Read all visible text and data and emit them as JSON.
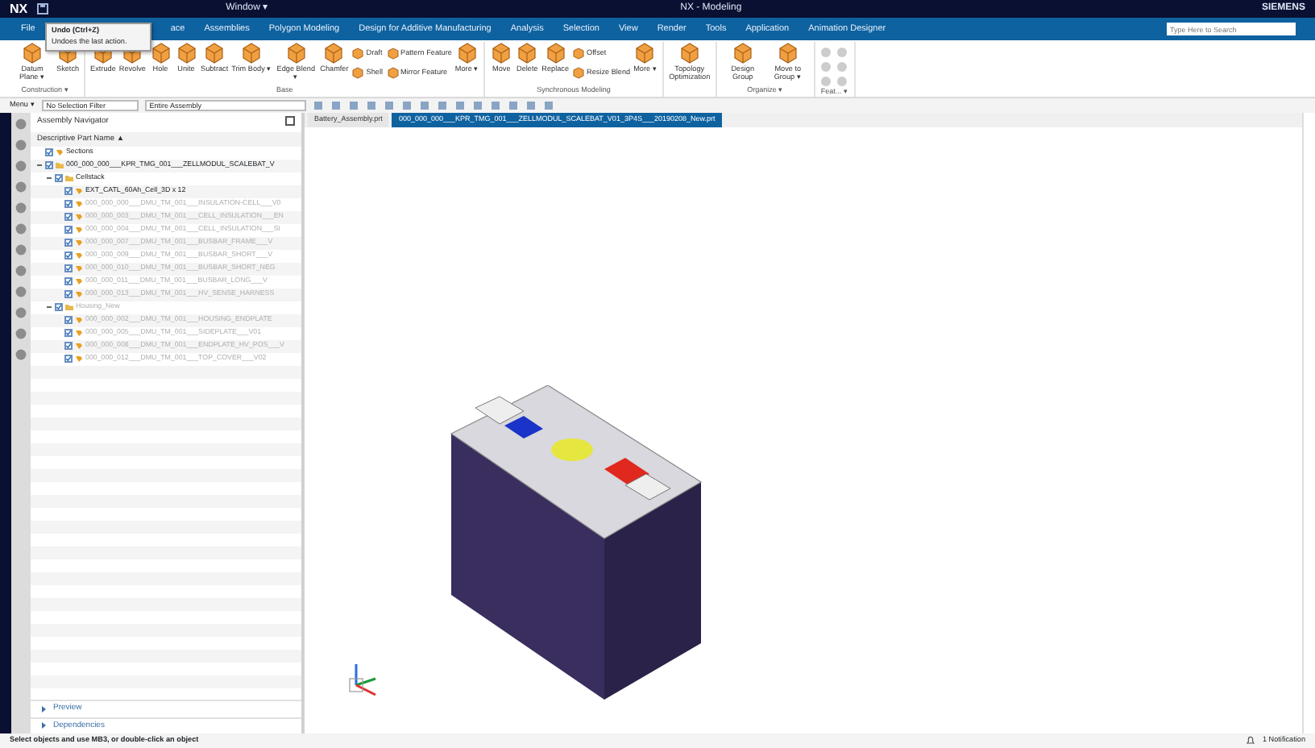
{
  "window": {
    "logo": "NX",
    "quick_access_menu": "Window ▾",
    "title": "NX - Modeling",
    "brand": "SIEMENS",
    "search": {
      "placeholder": "Type Here to Search"
    }
  },
  "menu_tabs": [
    {
      "label": "File",
      "selected": false
    },
    {
      "label": "ace",
      "selected": false
    },
    {
      "label": "Assemblies",
      "selected": false
    },
    {
      "label": "Polygon Modeling",
      "selected": false
    },
    {
      "label": "Design for Additive Manufacturing",
      "selected": false
    },
    {
      "label": "Analysis",
      "selected": false
    },
    {
      "label": "Selection",
      "selected": false
    },
    {
      "label": "View",
      "selected": false
    },
    {
      "label": "Render",
      "selected": false
    },
    {
      "label": "Tools",
      "selected": false
    },
    {
      "label": "Application",
      "selected": false
    },
    {
      "label": "Animation Designer",
      "selected": false
    }
  ],
  "tooltip": {
    "title": "Undo (Ctrl+Z)",
    "text": "Undoes the last action."
  },
  "ribbon_groups": [
    {
      "label": "Construction ▾",
      "items": [
        {
          "kind": "large",
          "label": "Datum Plane ▾"
        },
        {
          "kind": "large",
          "label": "Sketch"
        }
      ]
    },
    {
      "label": "Base",
      "items": [
        {
          "kind": "large",
          "label": "Extrude"
        },
        {
          "kind": "large",
          "label": "Revolve"
        },
        {
          "kind": "large",
          "label": "Hole"
        },
        {
          "kind": "large",
          "label": "Unite"
        },
        {
          "kind": "large",
          "label": "Subtract"
        },
        {
          "kind": "large",
          "label": "Trim Body ▾"
        },
        {
          "kind": "large",
          "label": "Edge Blend ▾"
        },
        {
          "kind": "large",
          "label": "Chamfer"
        },
        {
          "kind": "small",
          "label": "Draft"
        },
        {
          "kind": "small",
          "label": "Shell"
        },
        {
          "kind": "small",
          "label": "Pattern Feature"
        },
        {
          "kind": "small",
          "label": "Mirror Feature"
        },
        {
          "kind": "large",
          "label": "More ▾"
        }
      ]
    },
    {
      "label": "Synchronous Modeling",
      "items": [
        {
          "kind": "large",
          "label": "Move"
        },
        {
          "kind": "large",
          "label": "Delete"
        },
        {
          "kind": "large",
          "label": "Replace"
        },
        {
          "kind": "small",
          "label": "Offset"
        },
        {
          "kind": "small",
          "label": "Resize Blend"
        },
        {
          "kind": "large",
          "label": "More ▾"
        }
      ]
    },
    {
      "items": [
        {
          "kind": "large",
          "label": "Topology Optimization"
        }
      ]
    },
    {
      "label": "Organize ▾",
      "items": [
        {
          "kind": "large",
          "label": "Design Group"
        },
        {
          "kind": "large",
          "label": "Move to Group ▾"
        }
      ]
    },
    {
      "label": "Feat... ▾"
    }
  ],
  "selection_bar": {
    "menu": "Menu ▾",
    "filter": "No Selection Filter",
    "scope": "Entire Assembly"
  },
  "navigator": {
    "title": "Assembly Navigator",
    "column": "Descriptive Part Name ▲",
    "tree": [
      {
        "label": "Sections",
        "loaded": true
      },
      {
        "label": "000_000_000___KPR_TMG_001___ZELLMODUL_SCALEBAT_V",
        "loaded": true,
        "expanded": true,
        "children": [
          {
            "label": "Cellstack",
            "loaded": true,
            "expanded": true,
            "children": [
              {
                "label": "EXT_CATL_60Ah_Cell_3D x 12",
                "loaded": true
              },
              {
                "label": "000_000_000___DMU_TM_001___INSULATION-CELL___V0",
                "loaded": false
              },
              {
                "label": "000_000_003___DMU_TM_001___CELL_INSULATION___EN",
                "loaded": false
              },
              {
                "label": "000_000_004___DMU_TM_001___CELL_INSULATION___SI",
                "loaded": false
              },
              {
                "label": "000_000_007___DMU_TM_001___BUSBAR_FRAME___V",
                "loaded": false
              },
              {
                "label": "000_000_009___DMU_TM_001___BUSBAR_SHORT___V",
                "loaded": false
              },
              {
                "label": "000_000_010___DMU_TM_001___BUSBAR_SHORT_NEG",
                "loaded": false
              },
              {
                "label": "000_000_011___DMU_TM_001___BUSBAR_LONG___V",
                "loaded": false
              },
              {
                "label": "000_000_013___DMU_TM_001___HV_SENSE_HARNESS",
                "loaded": false
              }
            ]
          },
          {
            "label": "Housing_New",
            "loaded": false,
            "expanded": true,
            "children": [
              {
                "label": "000_000_002___DMU_TM_001___HOUSING_ENDPLATE",
                "loaded": false
              },
              {
                "label": "000_000_005___DMU_TM_001___SIDEPLATE___V01",
                "loaded": false
              },
              {
                "label": "000_000_008___DMU_TM_001___ENDPLATE_HV_POS___V",
                "loaded": false
              },
              {
                "label": "000_000_012___DMU_TM_001___TOP_COVER___V02",
                "loaded": false
              }
            ]
          }
        ]
      }
    ],
    "panels": [
      {
        "label": "Preview",
        "expanded": false
      },
      {
        "label": "Dependencies",
        "expanded": false
      }
    ]
  },
  "file_tabs": [
    {
      "label": "Battery_Assembly.prt",
      "selected": false
    },
    {
      "label": "000_000_000___KPR_TMG_001___ZELLMODUL_SCALEBAT_V01_3P4S___20190208_New.prt",
      "selected": true
    }
  ],
  "status_bar": {
    "prompt": "Select objects and use MB3, or double-click an object",
    "notification": "1 Notification"
  }
}
